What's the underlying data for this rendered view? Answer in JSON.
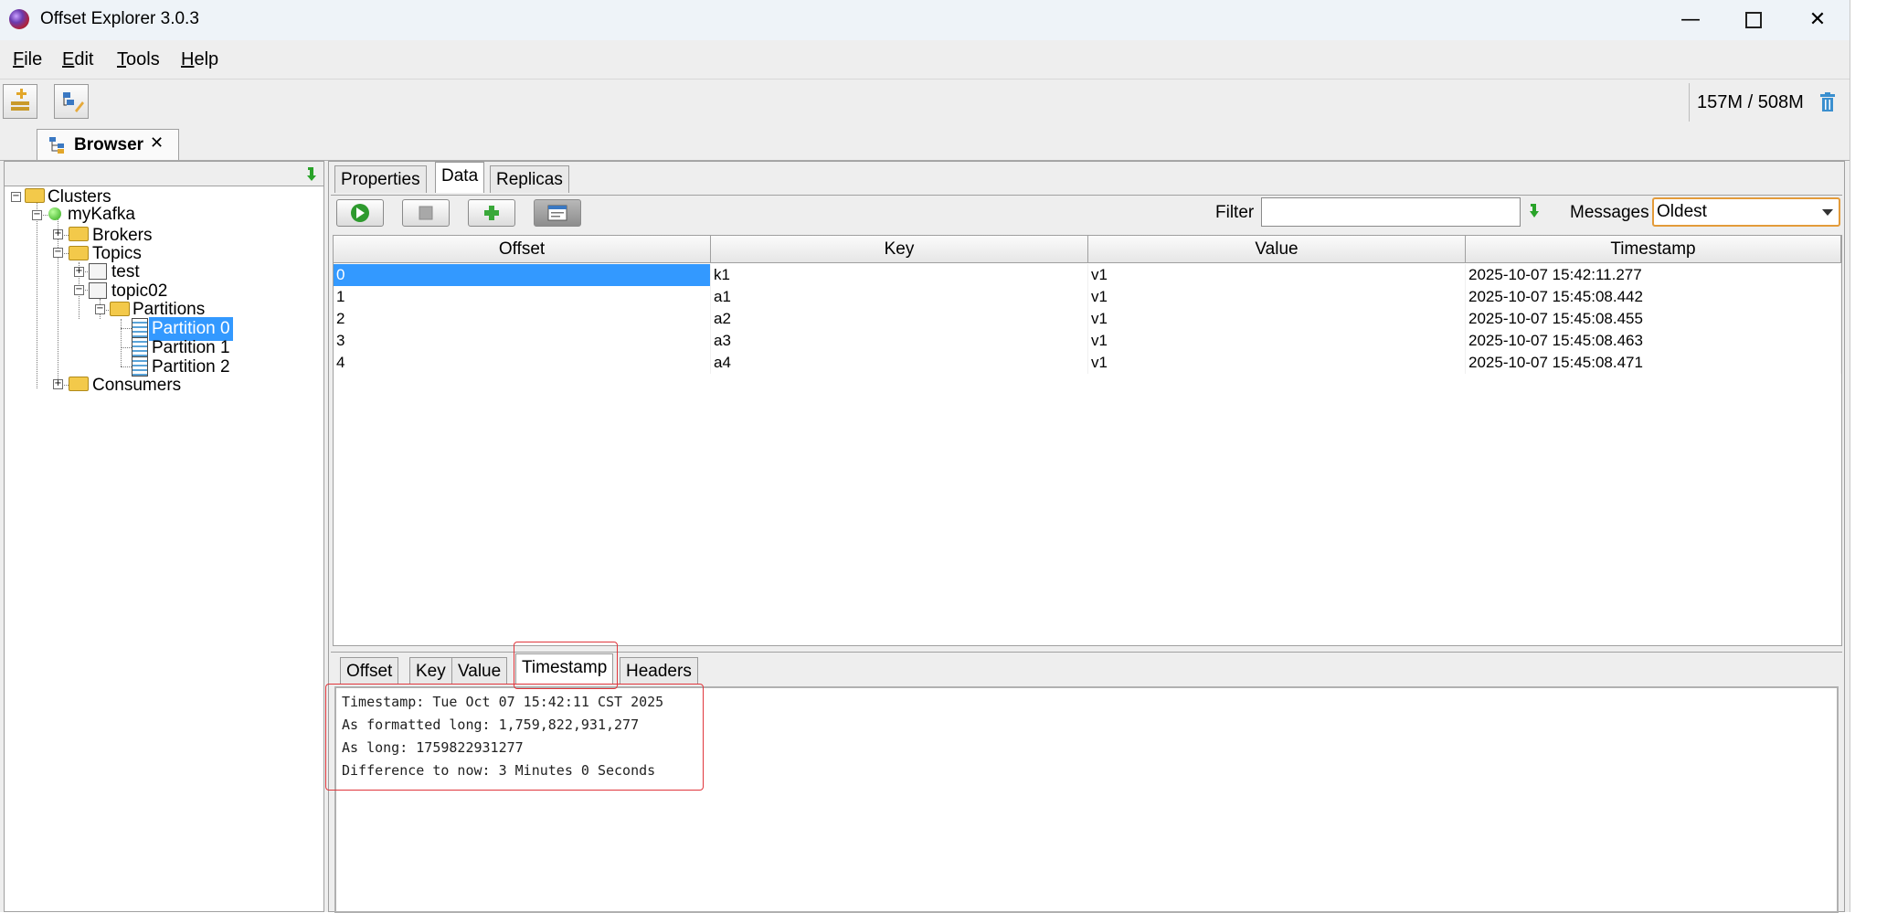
{
  "window": {
    "title": "Offset Explorer  3.0.3",
    "controls": {
      "minimize": "—",
      "close": "✕"
    }
  },
  "menu": [
    {
      "label": "File",
      "mnemonic": "F",
      "rest": "ile"
    },
    {
      "label": "Edit",
      "mnemonic": "E",
      "rest": "dit"
    },
    {
      "label": "Tools",
      "mnemonic": "T",
      "rest": "ools"
    },
    {
      "label": "Help",
      "mnemonic": "H",
      "rest": "elp"
    }
  ],
  "toolbar": {
    "memory": "157M / 508M",
    "icons": [
      "add-connection-icon",
      "edit-connection-icon",
      "trash-icon"
    ]
  },
  "browser_tab": {
    "label": "Browser",
    "close": "✕"
  },
  "tree": {
    "clusters": "Clusters",
    "cluster": "myKafka",
    "brokers": "Brokers",
    "topics": "Topics",
    "topic_test": "test",
    "topic02": "topic02",
    "partitions": "Partitions",
    "partition_items": [
      "Partition 0",
      "Partition 1",
      "Partition 2"
    ],
    "selected": "Partition 0",
    "consumers": "Consumers"
  },
  "main_tabs": [
    "Properties",
    "Data",
    "Replicas"
  ],
  "active_main_tab": "Data",
  "data_toolbar": {
    "filter_label": "Filter",
    "filter_value": "",
    "messages_label": "Messages",
    "messages_value": "Oldest"
  },
  "table": {
    "columns": [
      "Offset",
      "Key",
      "Value",
      "Timestamp"
    ],
    "rows": [
      [
        "0",
        "k1",
        "v1",
        "2025-10-07 15:42:11.277"
      ],
      [
        "1",
        "a1",
        "v1",
        "2025-10-07 15:45:08.442"
      ],
      [
        "2",
        "a2",
        "v1",
        "2025-10-07 15:45:08.455"
      ],
      [
        "3",
        "a3",
        "v1",
        "2025-10-07 15:45:08.463"
      ],
      [
        "4",
        "a4",
        "v1",
        "2025-10-07 15:45:08.471"
      ]
    ],
    "selected_row": 0
  },
  "detail_tabs": [
    "Offset",
    "Key",
    "Value",
    "Timestamp",
    "Headers"
  ],
  "active_detail_tab": "Timestamp",
  "detail_lines": [
    "Timestamp: Tue Oct 07 15:42:11 CST 2025",
    "As formatted long: 1,759,822,931,277",
    "As long: 1759822931277",
    "Difference to now: 3 Minutes 0 Seconds"
  ],
  "colors": {
    "selection": "#3399ff",
    "highlight_border": "#e0363c",
    "select_focus": "#e39b3a"
  }
}
